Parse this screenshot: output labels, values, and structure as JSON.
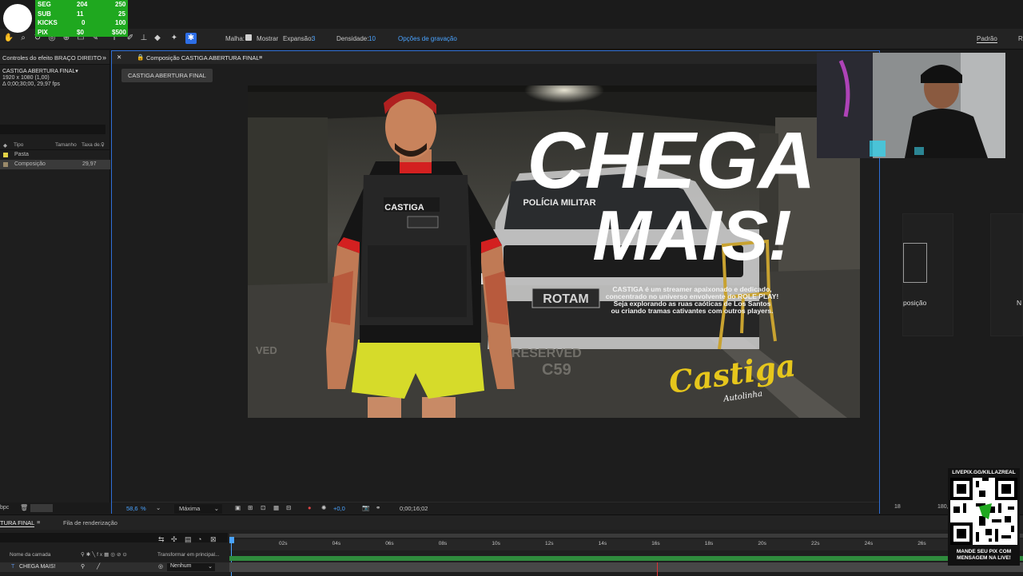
{
  "overlay": {
    "rows": [
      {
        "label": "SEG",
        "value": "204",
        "goal": "250"
      },
      {
        "label": "SUB",
        "value": "11",
        "goal": "25"
      },
      {
        "label": "KICKS",
        "value": "0",
        "goal": "100"
      },
      {
        "label": "PIX",
        "value": "$0",
        "goal": "$500"
      }
    ],
    "accent": "#1fa81f"
  },
  "toolbar": {
    "malha_label": "Malha:",
    "mostrar_label": "Mostrar",
    "expansao_label": "Expansão:",
    "expansao_value": "3",
    "densidade_label": "Densidade:",
    "densidade_value": "10",
    "opcoes_label": "Opções de gravação",
    "workspace_label": "Padrão",
    "workspace_next": "R"
  },
  "left_panel": {
    "header": "Controles do efeito BRAÇO DIREITO",
    "item_title": "CASTIGA ABERTURA FINAL▾",
    "item_size": "1920 x 1080 (1,00)",
    "item_duration": "Δ 0;00;30;00, 29,97 fps",
    "columns": [
      "Tipo",
      "Tamanho",
      "Taxa de..."
    ],
    "rows": [
      {
        "name": "Pasta",
        "size": "",
        "rate": "",
        "color": "#e2d246"
      },
      {
        "name": "Composição",
        "size": "",
        "rate": "29,97",
        "color": "#9a8a6a"
      }
    ],
    "footer_left": "bpc"
  },
  "composition": {
    "tab_title": "Composição CASTIGA ABERTURA FINAL",
    "chip": "CASTIGA ABERTURA FINAL",
    "artwork": {
      "headline_1": "CHEGA",
      "headline_2": "MAIS!",
      "blurb": [
        "CASTIGA é um streamer apaixonado e dedicado,",
        "concentrado no universo envolvente do ROLE PLAY!",
        "Seja explorando as ruas caóticas de Los Santos",
        "ou criando tramas cativantes com outros players."
      ],
      "vest_text": "CASTIGA",
      "plate_text": "ROTAM",
      "car_text": "POLÍCIA MILITAR",
      "floor_text_1": "RESERVED",
      "floor_text_2": "C59",
      "floor_text_3": "VED",
      "logo_text": "Castiga",
      "logo_sub": "Autolinha"
    },
    "footer": {
      "zoom": "58,6",
      "zoom_unit": "%",
      "quality": "Máxima",
      "exposure": "+0,0",
      "timecode": "0;00;16;02"
    }
  },
  "right_panel": {
    "label_1": "posição",
    "label_2": "N",
    "zoom_left": "18",
    "zoom_value": "180,2 %"
  },
  "timeline": {
    "tab_active": "TURA FINAL",
    "tab_render": "Fila de renderização",
    "ruler_ticks": [
      "02s",
      "04s",
      "06s",
      "08s",
      "10s",
      "12s",
      "14s",
      "16s",
      "18s",
      "20s",
      "22s",
      "24s",
      "26s"
    ],
    "col_layer_name": "Nome da camada",
    "col_transform": "Transformar em principal...",
    "layer_name": "CHEGA    MAIS!",
    "layer_parent": "Nenhum",
    "layer_parent_2": "Nenhum"
  },
  "qr": {
    "top_text": "LIVEPIX.GG/KILLAZREAL",
    "bottom_text_1": "MANDE SEU PIX COM",
    "bottom_text_2": "MENSAGEM NA LIVE!"
  }
}
